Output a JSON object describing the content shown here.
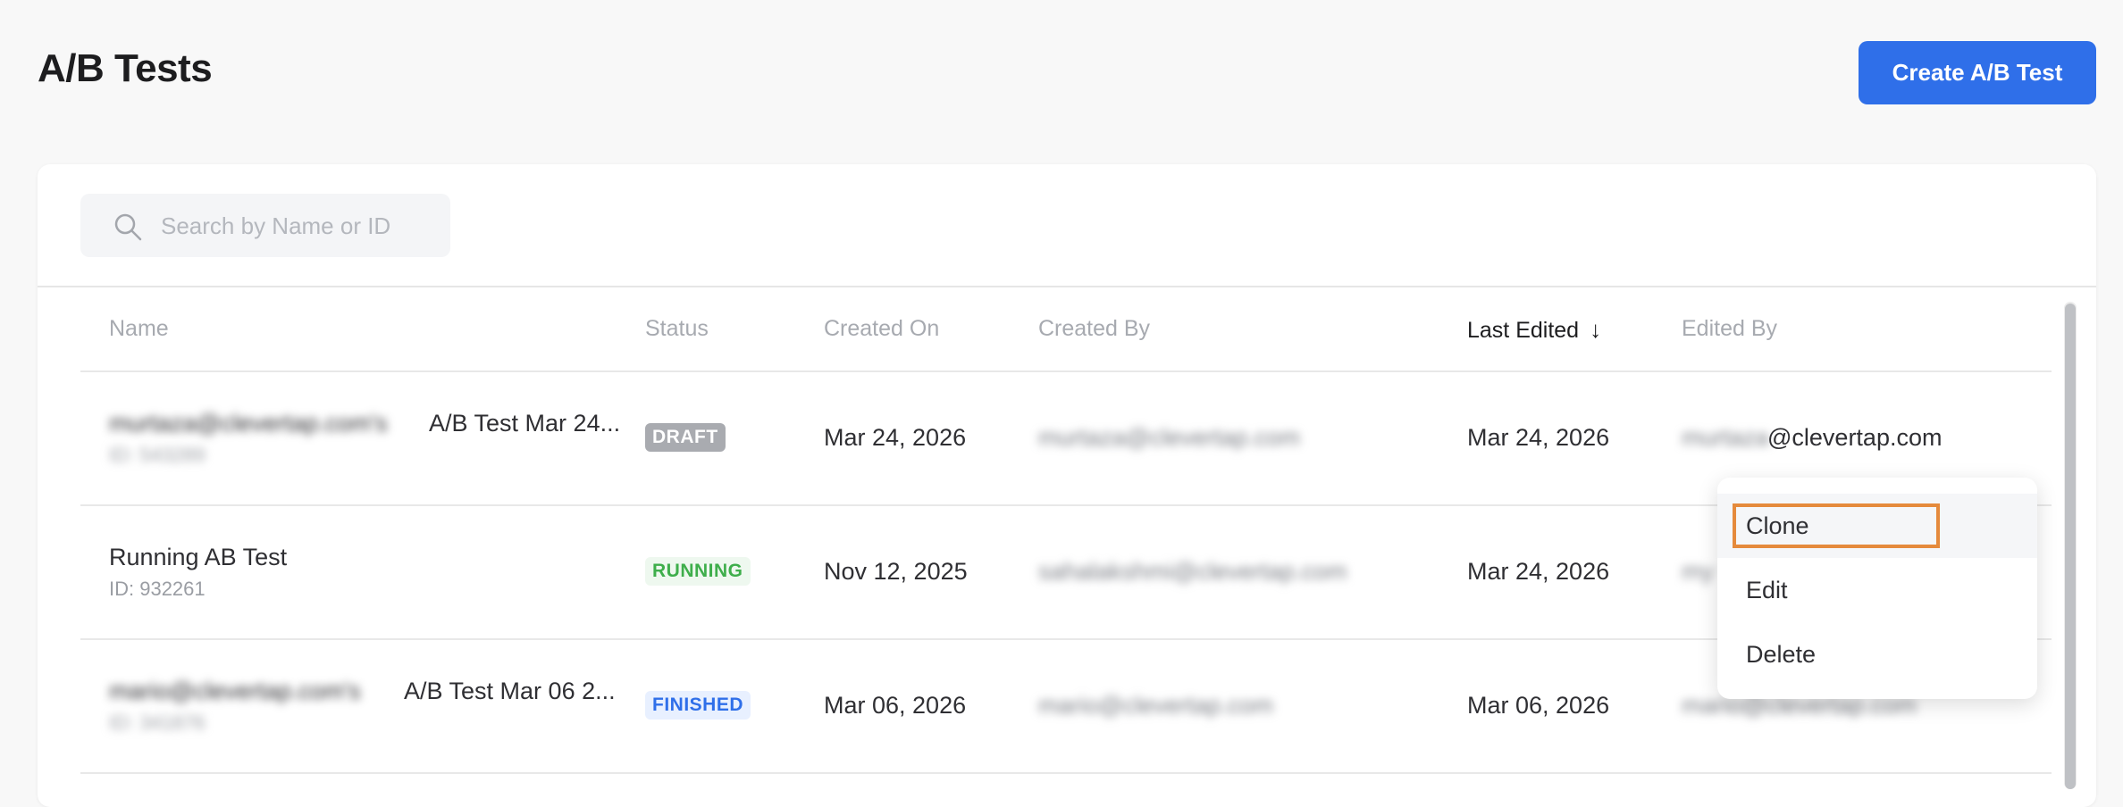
{
  "page": {
    "title": "A/B Tests"
  },
  "toolbar": {
    "create_label": "Create A/B Test"
  },
  "search": {
    "placeholder": "Search by Name or ID",
    "value": ""
  },
  "table": {
    "columns": [
      "Name",
      "Status",
      "Created On",
      "Created By",
      "Last Edited",
      "Edited By"
    ],
    "sort_indicator": "↓",
    "rows": [
      {
        "name_prefix": "murtaza@clevertap.com's",
        "name": "A/B Test Mar 24...",
        "id": "ID: 543289",
        "status": "DRAFT",
        "created_on": "Mar 24, 2026",
        "created_by": "murtaza@clevertap.com",
        "last_edited": "Mar 24, 2026",
        "edited_by_hidden": "murtaza",
        "edited_by": "@clevertap.com"
      },
      {
        "name_prefix": "",
        "name": "Running AB Test",
        "id": "ID: 932261",
        "status": "RUNNING",
        "created_on": "Nov 12, 2025",
        "created_by": "sahalakshmi@clevertap.com",
        "last_edited": "Mar 24, 2026",
        "edited_by_hidden": "my",
        "edited_by": ""
      },
      {
        "name_prefix": "mario@clevertap.com's",
        "name": "A/B Test Mar 06 2...",
        "id": "ID: 341876",
        "status": "FINISHED",
        "created_on": "Mar 06, 2026",
        "created_by": "mario@clevertap.com",
        "last_edited": "Mar 06, 2026",
        "edited_by_hidden": "mario@clevertap.com",
        "edited_by": ""
      }
    ]
  },
  "context_menu": {
    "items": [
      "Clone",
      "Edit",
      "Delete"
    ]
  },
  "colors": {
    "accent": "#2f6fe9",
    "draft_badge": "#a9abb0",
    "running_text": "#3eae4b",
    "finished_text": "#2f6fe9",
    "focus_ring": "#e58a3c"
  },
  "icons": {
    "search": "search-icon",
    "sort": "arrow-down-icon"
  }
}
